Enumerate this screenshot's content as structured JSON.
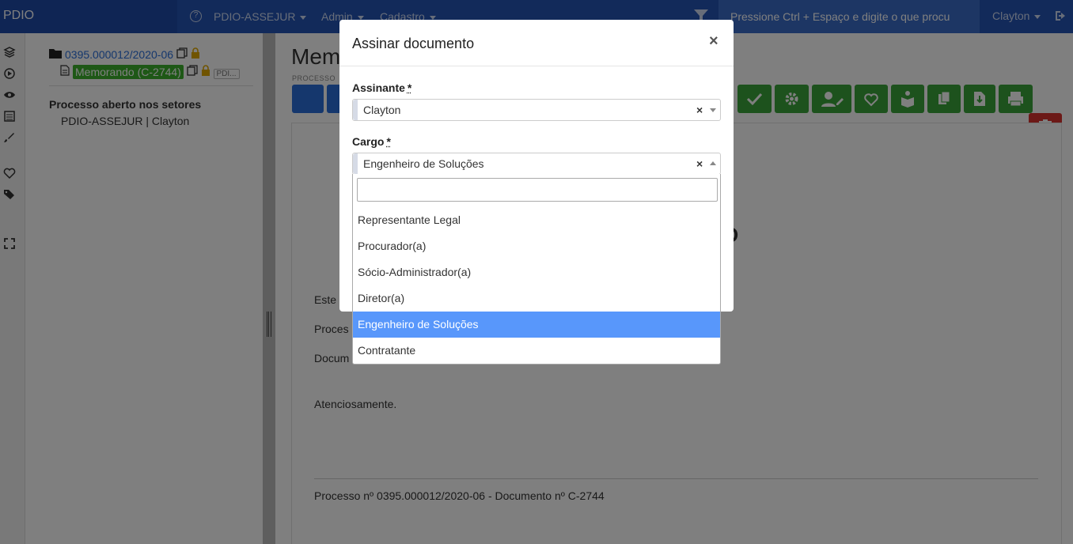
{
  "navbar": {
    "brand": "PDIO",
    "items": [
      "PDIO-ASSEJUR",
      "Admin",
      "Cadastro"
    ],
    "search_placeholder": "Pressione Ctrl + Espaço e digite o que procu",
    "user": "Clayton"
  },
  "tree": {
    "process_number": "0395.000012/2020-06",
    "document_label": "Memorando (C-2744)",
    "document_tag": "PDI...",
    "setores_title": "Processo aberto nos setores",
    "setores_item": "PDIO-ASSEJUR | Clayton"
  },
  "main": {
    "title": "Mem",
    "subtitle": "PROCESSO",
    "paper_lines": {
      "este": "Este",
      "proces": "Proces",
      "docum": "Docum",
      "atenciosamente": "Atenciosamente.",
      "footer": "Processo nº 0395.000012/2020-06 - Documento nº C-2744"
    }
  },
  "modal": {
    "title": "Assinar documento",
    "close": "×",
    "assinante_label": "Assinante",
    "assinante_req": "*",
    "assinante_value": "Clayton",
    "cargo_label": "Cargo",
    "cargo_req": "*",
    "cargo_value": "Engenheiro de Soluções",
    "clear": "×",
    "options": [
      "Representante Legal",
      "Procurador(a)",
      "Sócio-Administrador(a)",
      "Diretor(a)",
      "Engenheiro de Soluções",
      "Contratante"
    ],
    "selected_index": 4
  },
  "colors": {
    "navbar": "#2454b5",
    "primary": "#2a6fdb",
    "success": "#3aa53a",
    "danger": "#d9322e",
    "highlight": "#5897fb"
  }
}
